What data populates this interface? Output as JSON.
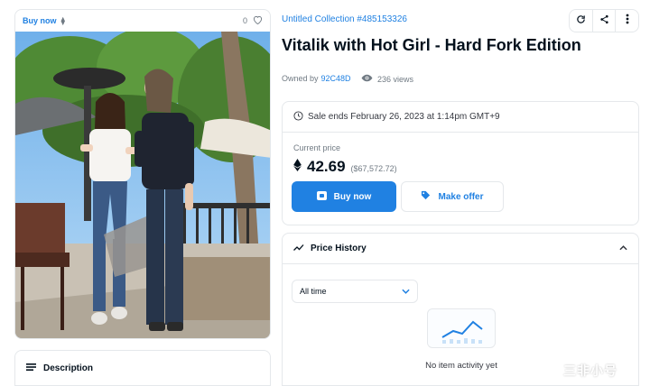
{
  "image_card": {
    "buy_now": "Buy now",
    "eth_symbol": "⧫",
    "favorites_count": "0",
    "favorite_icon": "heart-icon"
  },
  "description": {
    "label": "Description",
    "icon": "list-icon"
  },
  "collection": "Untitled Collection #485153326",
  "title": "Vitalik with Hot Girl - Hard Fork Edition",
  "owner": {
    "prefix": "Owned by",
    "name": "92C48D"
  },
  "views": "236 views",
  "actions": {
    "icons": [
      "refresh-icon",
      "share-icon",
      "more-icon"
    ]
  },
  "sale": {
    "ends_text": "Sale ends February 26, 2023 at 1:14pm GMT+9",
    "current_price_label": "Current price",
    "price": "42.69",
    "usd": "($67,572.72)",
    "buy_label": "Buy now",
    "offer_label": "Make offer"
  },
  "price_history": {
    "title": "Price History",
    "select_value": "All time",
    "empty_text": "No item activity yet"
  },
  "watermark": "三非小号",
  "colors": {
    "accent": "#2081e2",
    "text": "#04111d",
    "muted": "#707a83",
    "border": "#e5e8eb"
  }
}
